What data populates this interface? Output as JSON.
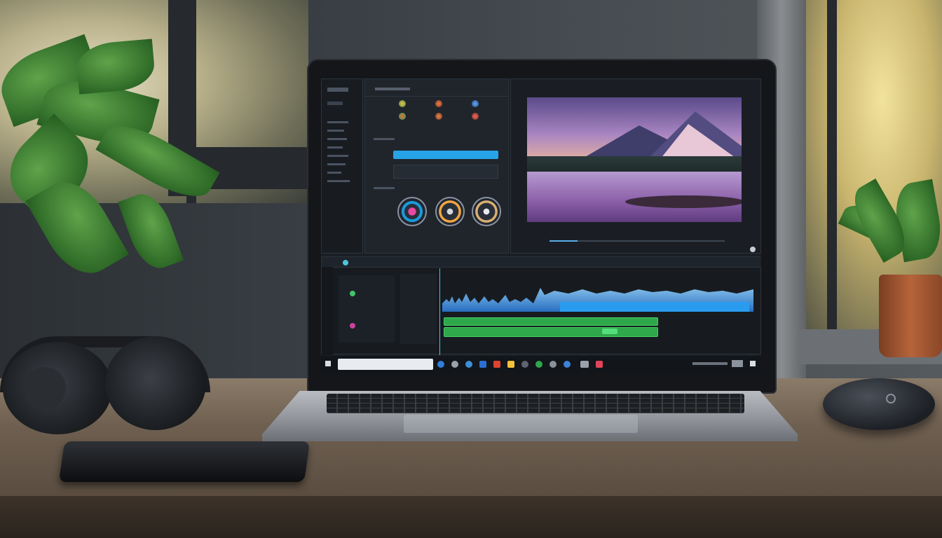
{
  "scene": {
    "description_free": true,
    "objects": [
      "window-frame",
      "potted-plant",
      "laptop",
      "headphones",
      "smartphone",
      "mouse",
      "desk"
    ]
  },
  "editor": {
    "app_title": "",
    "sidebar": {
      "items": [
        "",
        "",
        "",
        "",
        "",
        "",
        "",
        ""
      ]
    },
    "effects_panel": {
      "rows": 3
    },
    "viewer": {
      "image": "mountain-lake-sunset"
    },
    "timeline": {
      "tracks": 5
    },
    "taskbar": {
      "search_placeholder": ""
    }
  },
  "colors": {
    "accent_blue": "#27a4e8",
    "clip_green": "#2ea84a",
    "waveform_blue": "#3a8fe6",
    "panel_bg": "#20252c"
  }
}
